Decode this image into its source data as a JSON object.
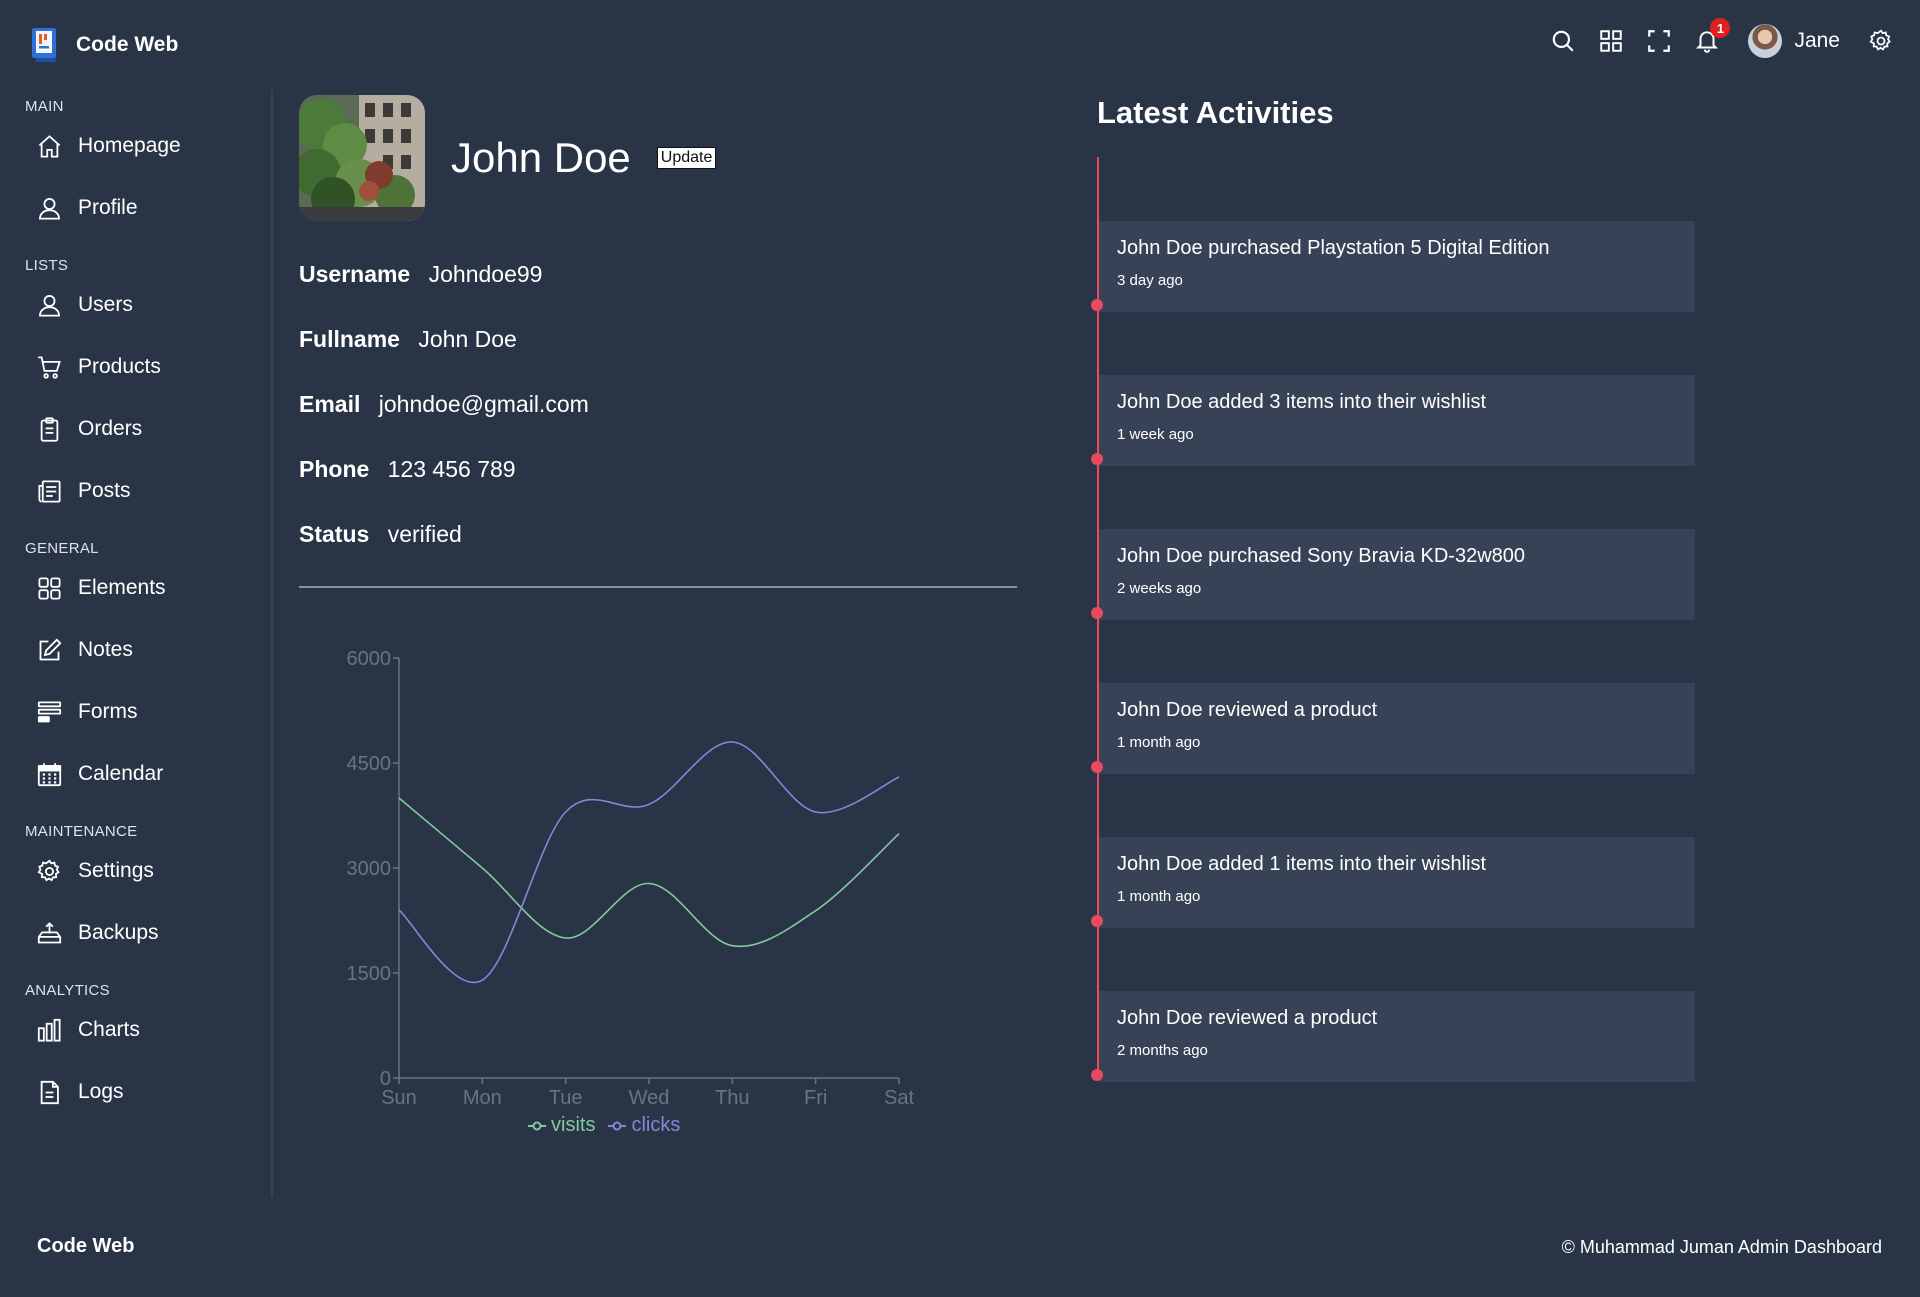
{
  "brand": {
    "name": "Code Web"
  },
  "topbar": {
    "notification_count": "1",
    "user_name": "Jane"
  },
  "sidebar": {
    "sections": [
      {
        "title": "MAIN",
        "items": [
          {
            "label": "Homepage",
            "icon": "home-icon"
          },
          {
            "label": "Profile",
            "icon": "user-icon"
          }
        ]
      },
      {
        "title": "LISTS",
        "items": [
          {
            "label": "Users",
            "icon": "user-icon"
          },
          {
            "label": "Products",
            "icon": "cart-icon"
          },
          {
            "label": "Orders",
            "icon": "clipboard-icon"
          },
          {
            "label": "Posts",
            "icon": "newspaper-icon"
          }
        ]
      },
      {
        "title": "GENERAL",
        "items": [
          {
            "label": "Elements",
            "icon": "grid-icon"
          },
          {
            "label": "Notes",
            "icon": "edit-icon"
          },
          {
            "label": "Forms",
            "icon": "forms-icon"
          },
          {
            "label": "Calendar",
            "icon": "calendar-icon"
          }
        ]
      },
      {
        "title": "MAINTENANCE",
        "items": [
          {
            "label": "Settings",
            "icon": "gear-icon"
          },
          {
            "label": "Backups",
            "icon": "backup-icon"
          }
        ]
      },
      {
        "title": "ANALYTICS",
        "items": [
          {
            "label": "Charts",
            "icon": "bar-chart-icon"
          },
          {
            "label": "Logs",
            "icon": "file-icon"
          }
        ]
      }
    ]
  },
  "profile": {
    "name": "John Doe",
    "update_label": "Update",
    "fields": [
      {
        "label": "Username",
        "value": "Johndoe99"
      },
      {
        "label": "Fullname",
        "value": "John Doe"
      },
      {
        "label": "Email",
        "value": "johndoe@gmail.com"
      },
      {
        "label": "Phone",
        "value": "123 456 789"
      },
      {
        "label": "Status",
        "value": "verified"
      }
    ]
  },
  "chart_data": {
    "type": "line",
    "categories": [
      "Sun",
      "Mon",
      "Tue",
      "Wed",
      "Thu",
      "Fri",
      "Sat"
    ],
    "yticks": [
      0,
      1500,
      3000,
      4500,
      6000
    ],
    "ylim": [
      0,
      6000
    ],
    "series": [
      {
        "name": "visits",
        "color": "#82ca9d",
        "values": [
          4000,
          3000,
          2000,
          2780,
          1890,
          2390,
          3490
        ]
      },
      {
        "name": "clicks",
        "color": "#8884d8",
        "values": [
          2400,
          1398,
          3800,
          3908,
          4800,
          3800,
          4300
        ]
      }
    ],
    "legend": "bottom",
    "grid": false
  },
  "activities": {
    "title": "Latest Activities",
    "items": [
      {
        "text": "John Doe purchased Playstation 5 Digital Edition",
        "time": "3 day ago"
      },
      {
        "text": "John Doe added 3 items into their wishlist",
        "time": "1 week ago"
      },
      {
        "text": "John Doe purchased Sony Bravia KD-32w800",
        "time": "2 weeks ago"
      },
      {
        "text": "John Doe reviewed a product",
        "time": "1 month ago"
      },
      {
        "text": "John Doe added 1 items into their wishlist",
        "time": "1 month ago"
      },
      {
        "text": "John Doe reviewed a product",
        "time": "2 months ago"
      }
    ]
  },
  "footer": {
    "brand": "Code Web",
    "copyright": "© Muhammad Juman Admin Dashboard"
  },
  "colors": {
    "background": "#2a3447",
    "card": "#384256",
    "accent": "#e84a5f"
  }
}
